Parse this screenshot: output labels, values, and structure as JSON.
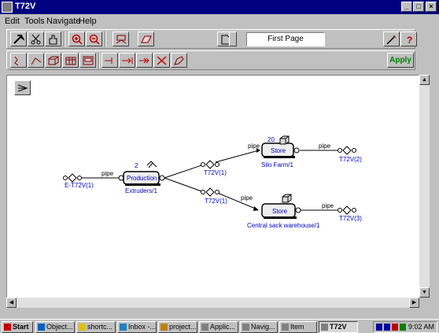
{
  "window": {
    "title": "T72V"
  },
  "menu": {
    "items": [
      "Edit",
      "Tools",
      "Navigate",
      "Help"
    ]
  },
  "toolbar": {
    "page_label": "First Page",
    "apply_label": "Apply"
  },
  "diagram": {
    "source_label": "E-T72V(1)",
    "pipe_labels": [
      "pipe",
      "pipe",
      "pipe",
      "pipe",
      "pipe"
    ],
    "production": {
      "name": "Production",
      "count": "2",
      "caption": "Extruders/1"
    },
    "store1": {
      "name": "Store",
      "count": "20",
      "caption": "Silo Farm/1"
    },
    "store2": {
      "name": "Store",
      "caption": "Central sack warehouse/1"
    },
    "junction_labels": [
      "T72V(1)",
      "T72V(1)",
      "T72V(2)",
      "T72V(3)"
    ]
  },
  "taskbar": {
    "start_label": "Start",
    "tasks": [
      "Object...",
      "shortc...",
      "Inbox -...",
      "project...",
      "Applic...",
      "Navig...",
      "Item",
      "T72V"
    ],
    "clock": "9:02 AM"
  },
  "colors": {
    "titlebar": "#000080",
    "link_text": "#0000c0",
    "apply_text": "#008000"
  }
}
